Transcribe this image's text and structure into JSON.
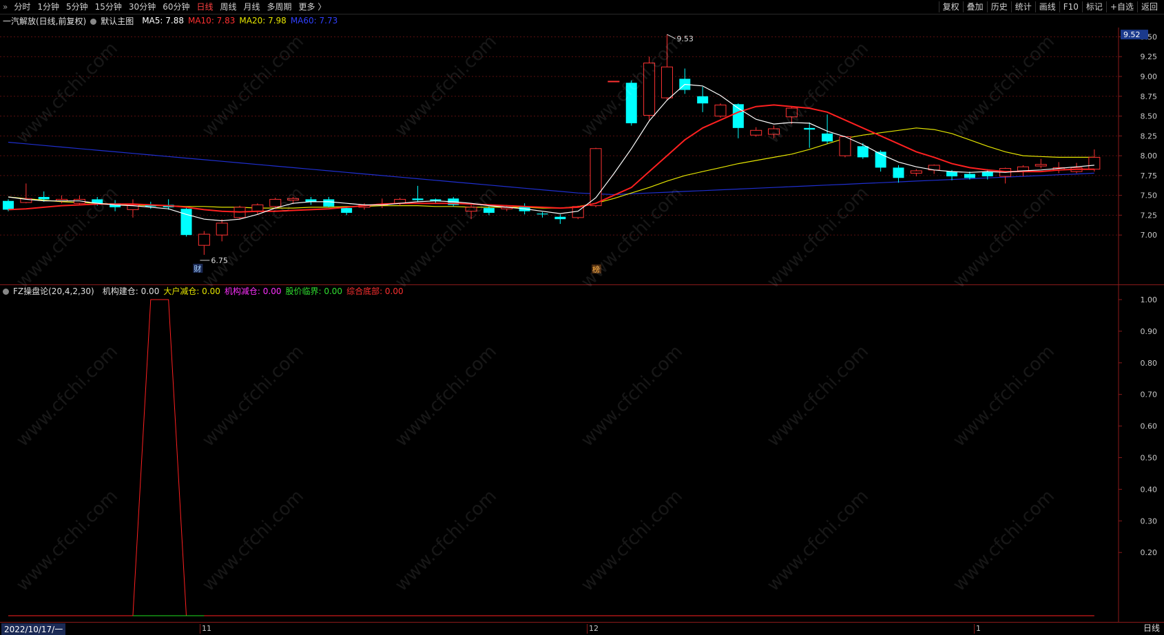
{
  "menu": {
    "lead": "»",
    "items": [
      "分时",
      "1分钟",
      "5分钟",
      "15分钟",
      "30分钟",
      "60分钟",
      "日线",
      "周线",
      "月线",
      "多周期",
      "更多 〉"
    ],
    "active_index": 6
  },
  "right_menu": [
    "复权",
    "叠加",
    "历史",
    "统计",
    "画线",
    "F10",
    "标记",
    "+自选",
    "返回"
  ],
  "info": {
    "stock": "一汽解放(日线,前复权)",
    "main_label": "默认主图",
    "ma5": "MA5: 7.88",
    "ma10": "MA10: 7.83",
    "ma20": "MA20: 7.98",
    "ma60": "MA60: 7.73"
  },
  "indicator": {
    "name": "FZ操盘论(20,4,2,30)",
    "v1": "机构建仓: 0.00",
    "v2": "大户减仓: 0.00",
    "v3": "机构减仓: 0.00",
    "v4": "股价临界: 0.00",
    "v5": "综合底部: 0.00"
  },
  "price_labels": {
    "current": "9.52",
    "high": "9.53",
    "low": "6.75",
    "tag1": "财",
    "tag2": "榜"
  },
  "xaxis": {
    "date": "2022/10/17/一",
    "m11": "11",
    "m12": "12",
    "m1": "1",
    "period": "日线"
  },
  "watermark": "www.cfchi.com",
  "colors": {
    "up": "#ff3232",
    "down": "#00ffff",
    "ma5": "#ffffff",
    "ma10": "#ff2020",
    "ma20": "#e6e600",
    "ma60": "#1f2fd0",
    "grid": "#5a0f0f"
  },
  "chart_data": {
    "type": "candlestick",
    "y_ticks_main": [
      "9.50",
      "9.25",
      "9.00",
      "8.75",
      "8.50",
      "8.25",
      "8.00",
      "7.75",
      "7.50",
      "7.25",
      "7.00"
    ],
    "y_ticks_ind": [
      "1.00",
      "0.90",
      "0.80",
      "0.70",
      "0.60",
      "0.50",
      "0.40",
      "0.30",
      "0.20"
    ],
    "candles": [
      [
        7.43,
        7.32,
        7.45,
        7.3
      ],
      [
        7.41,
        7.46,
        7.65,
        7.4
      ],
      [
        7.48,
        7.45,
        7.55,
        7.42
      ],
      [
        7.43,
        7.45,
        7.5,
        7.4
      ],
      [
        7.4,
        7.45,
        7.5,
        7.38
      ],
      [
        7.45,
        7.4,
        7.48,
        7.37
      ],
      [
        7.4,
        7.35,
        7.44,
        7.3
      ],
      [
        7.32,
        7.38,
        7.45,
        7.22
      ],
      [
        7.38,
        7.36,
        7.42,
        7.33
      ],
      [
        7.38,
        7.35,
        7.45,
        7.32
      ],
      [
        7.33,
        7.0,
        7.35,
        6.98
      ],
      [
        6.87,
        7.01,
        7.05,
        6.75
      ],
      [
        7.0,
        7.15,
        7.2,
        6.92
      ],
      [
        7.22,
        7.35,
        7.37,
        7.2
      ],
      [
        7.3,
        7.38,
        7.4,
        7.26
      ],
      [
        7.36,
        7.45,
        7.47,
        7.33
      ],
      [
        7.44,
        7.46,
        7.48,
        7.4
      ],
      [
        7.45,
        7.42,
        7.48,
        7.38
      ],
      [
        7.45,
        7.36,
        7.48,
        7.35
      ],
      [
        7.34,
        7.28,
        7.36,
        7.25
      ],
      [
        7.35,
        7.38,
        7.4,
        7.32
      ],
      [
        7.39,
        7.39,
        7.46,
        7.34
      ],
      [
        7.4,
        7.45,
        7.47,
        7.37
      ],
      [
        7.46,
        7.44,
        7.62,
        7.42
      ],
      [
        7.45,
        7.43,
        7.46,
        7.4
      ],
      [
        7.46,
        7.38,
        7.48,
        7.36
      ],
      [
        7.3,
        7.35,
        7.38,
        7.2
      ],
      [
        7.34,
        7.28,
        7.36,
        7.25
      ],
      [
        7.33,
        7.35,
        7.38,
        7.3
      ],
      [
        7.36,
        7.3,
        7.4,
        7.26
      ],
      [
        7.27,
        7.26,
        7.29,
        7.22
      ],
      [
        7.23,
        7.2,
        7.26,
        7.14
      ],
      [
        7.22,
        7.36,
        7.37,
        7.2
      ],
      [
        7.37,
        8.09,
        8.1,
        7.35
      ],
      [
        8.94,
        8.94,
        8.94,
        8.94
      ],
      [
        8.92,
        8.41,
        8.95,
        8.38
      ],
      [
        8.51,
        9.17,
        9.25,
        8.45
      ],
      [
        8.73,
        9.12,
        9.53,
        8.7
      ],
      [
        8.97,
        8.83,
        9.1,
        8.78
      ],
      [
        8.75,
        8.66,
        8.87,
        8.55
      ],
      [
        8.5,
        8.64,
        8.66,
        8.48
      ],
      [
        8.65,
        8.35,
        8.66,
        8.22
      ],
      [
        8.26,
        8.32,
        8.36,
        8.24
      ],
      [
        8.27,
        8.34,
        8.38,
        8.22
      ],
      [
        8.49,
        8.6,
        8.62,
        8.4
      ],
      [
        8.35,
        8.33,
        8.42,
        8.1
      ],
      [
        8.28,
        8.18,
        8.52,
        8.15
      ],
      [
        8.0,
        8.24,
        8.25,
        7.98
      ],
      [
        8.12,
        7.98,
        8.16,
        7.96
      ],
      [
        8.05,
        7.85,
        8.07,
        7.8
      ],
      [
        7.85,
        7.72,
        7.88,
        7.66
      ],
      [
        7.78,
        7.81,
        7.83,
        7.74
      ],
      [
        7.82,
        7.88,
        7.89,
        7.77
      ],
      [
        7.8,
        7.74,
        7.82,
        7.69
      ],
      [
        7.77,
        7.72,
        7.8,
        7.7
      ],
      [
        7.8,
        7.74,
        7.83,
        7.7
      ],
      [
        7.74,
        7.84,
        7.85,
        7.65
      ],
      [
        7.81,
        7.86,
        7.88,
        7.74
      ],
      [
        7.87,
        7.89,
        7.96,
        7.84
      ],
      [
        7.82,
        7.85,
        7.92,
        7.78
      ],
      [
        7.8,
        7.85,
        7.91,
        7.78
      ],
      [
        7.83,
        7.98,
        8.08,
        7.8
      ]
    ],
    "ma5": [
      7.48,
      7.45,
      7.43,
      7.43,
      7.43,
      7.4,
      7.38,
      7.37,
      7.35,
      7.33,
      7.26,
      7.2,
      7.18,
      7.2,
      7.26,
      7.34,
      7.4,
      7.42,
      7.42,
      7.4,
      7.38,
      7.38,
      7.4,
      7.42,
      7.43,
      7.42,
      7.4,
      7.37,
      7.35,
      7.33,
      7.3,
      7.27,
      7.3,
      7.47,
      7.77,
      8.09,
      8.44,
      8.7,
      8.9,
      8.88,
      8.76,
      8.6,
      8.46,
      8.4,
      8.42,
      8.41,
      8.31,
      8.24,
      8.14,
      8.02,
      7.92,
      7.86,
      7.82,
      7.8,
      7.79,
      7.8,
      7.79,
      7.81,
      7.82,
      7.84,
      7.86,
      7.88
    ],
    "ma10": [
      7.32,
      7.33,
      7.35,
      7.37,
      7.38,
      7.39,
      7.39,
      7.39,
      7.38,
      7.37,
      7.35,
      7.32,
      7.3,
      7.29,
      7.3,
      7.3,
      7.31,
      7.32,
      7.33,
      7.35,
      7.37,
      7.39,
      7.4,
      7.4,
      7.4,
      7.4,
      7.39,
      7.38,
      7.37,
      7.36,
      7.35,
      7.34,
      7.35,
      7.4,
      7.5,
      7.6,
      7.8,
      8.0,
      8.2,
      8.35,
      8.45,
      8.55,
      8.62,
      8.64,
      8.62,
      8.6,
      8.55,
      8.45,
      8.35,
      8.25,
      8.15,
      8.05,
      7.98,
      7.9,
      7.85,
      7.82,
      7.8,
      7.8,
      7.8,
      7.82,
      7.83,
      7.83
    ],
    "ma20": [
      7.48,
      7.46,
      7.44,
      7.42,
      7.41,
      7.4,
      7.39,
      7.38,
      7.37,
      7.37,
      7.36,
      7.36,
      7.35,
      7.35,
      7.34,
      7.34,
      7.34,
      7.35,
      7.35,
      7.36,
      7.36,
      7.37,
      7.37,
      7.37,
      7.36,
      7.36,
      7.35,
      7.35,
      7.35,
      7.35,
      7.34,
      7.34,
      7.36,
      7.4,
      7.46,
      7.53,
      7.6,
      7.68,
      7.75,
      7.8,
      7.85,
      7.9,
      7.94,
      7.98,
      8.02,
      8.08,
      8.15,
      8.22,
      8.26,
      8.29,
      8.32,
      8.35,
      8.33,
      8.28,
      8.2,
      8.12,
      8.05,
      8.0,
      7.99,
      7.98,
      7.98,
      7.98
    ],
    "ma60": [
      8.17,
      8.15,
      8.13,
      8.11,
      8.09,
      8.07,
      8.05,
      8.03,
      8.01,
      7.99,
      7.97,
      7.95,
      7.93,
      7.91,
      7.89,
      7.87,
      7.85,
      7.83,
      7.81,
      7.79,
      7.77,
      7.75,
      7.73,
      7.71,
      7.69,
      7.67,
      7.65,
      7.63,
      7.61,
      7.59,
      7.57,
      7.55,
      7.53,
      7.52,
      7.51,
      7.52,
      7.53,
      7.54,
      7.55,
      7.56,
      7.57,
      7.58,
      7.59,
      7.6,
      7.61,
      7.62,
      7.63,
      7.64,
      7.65,
      7.66,
      7.67,
      7.68,
      7.69,
      7.7,
      7.71,
      7.72,
      7.73,
      7.74,
      7.75,
      7.76,
      7.77,
      7.78
    ],
    "ind_series": [
      0,
      0,
      0,
      0,
      0,
      0,
      0,
      0,
      1,
      1,
      0,
      0,
      0,
      0,
      0,
      0,
      0,
      0,
      0,
      0,
      0,
      0,
      0,
      0,
      0,
      0,
      0,
      0,
      0,
      0,
      0,
      0,
      0,
      0,
      0,
      0,
      0,
      0,
      0,
      0,
      0,
      0,
      0,
      0,
      0,
      0,
      0,
      0,
      0,
      0,
      0,
      0,
      0,
      0,
      0,
      0,
      0,
      0,
      0,
      0,
      0,
      0
    ]
  }
}
